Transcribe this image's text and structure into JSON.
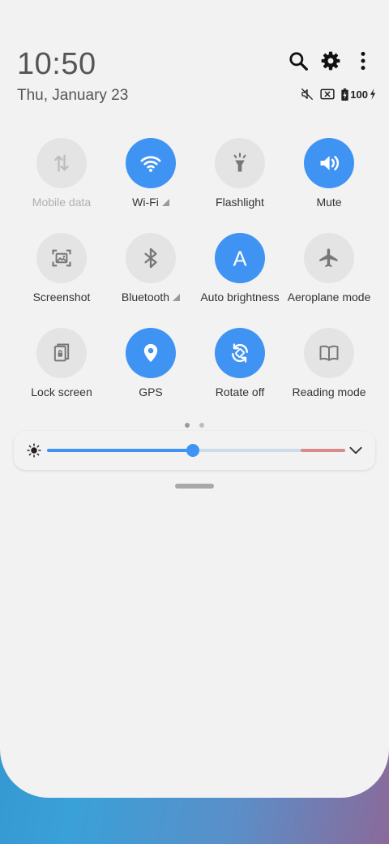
{
  "header": {
    "time": "10:50",
    "date": "Thu, January 23",
    "actions": [
      {
        "name": "search-button",
        "icon": "search-icon"
      },
      {
        "name": "settings-button",
        "icon": "gear-icon"
      },
      {
        "name": "more-options-button",
        "icon": "more-vertical-icon"
      }
    ]
  },
  "status": {
    "icons": [
      "mute-icon",
      "no-sim-icon",
      "battery-icon",
      "charging-icon"
    ],
    "battery_level": "100"
  },
  "tiles": [
    {
      "label": "Mobile data",
      "icon": "mobile-data-icon",
      "state": "disabled"
    },
    {
      "label": "Wi-Fi",
      "icon": "wifi-icon",
      "state": "on",
      "expandable": true
    },
    {
      "label": "Flashlight",
      "icon": "flashlight-icon",
      "state": "off"
    },
    {
      "label": "Mute",
      "icon": "volume-icon",
      "state": "on"
    },
    {
      "label": "Screenshot",
      "icon": "screenshot-icon",
      "state": "off"
    },
    {
      "label": "Bluetooth",
      "icon": "bluetooth-icon",
      "state": "off",
      "expandable": true
    },
    {
      "label": "Auto brightness",
      "icon": "auto-brightness-icon",
      "state": "on"
    },
    {
      "label": "Aeroplane mode",
      "icon": "airplane-icon",
      "state": "off"
    },
    {
      "label": "Lock screen",
      "icon": "lock-screen-icon",
      "state": "off"
    },
    {
      "label": "GPS",
      "icon": "location-icon",
      "state": "on"
    },
    {
      "label": "Rotate off",
      "icon": "rotate-icon",
      "state": "on"
    },
    {
      "label": "Reading mode",
      "icon": "book-icon",
      "state": "off"
    }
  ],
  "pagination": {
    "pages": 2,
    "current": 1
  },
  "brightness": {
    "level": 0.49,
    "high_zone_start": 0.85
  },
  "colors": {
    "accent": "#3f93f3",
    "tile_off": "#e4e4e4",
    "panel": "#f2f2f2",
    "brightness_high": "#d98a8a"
  }
}
